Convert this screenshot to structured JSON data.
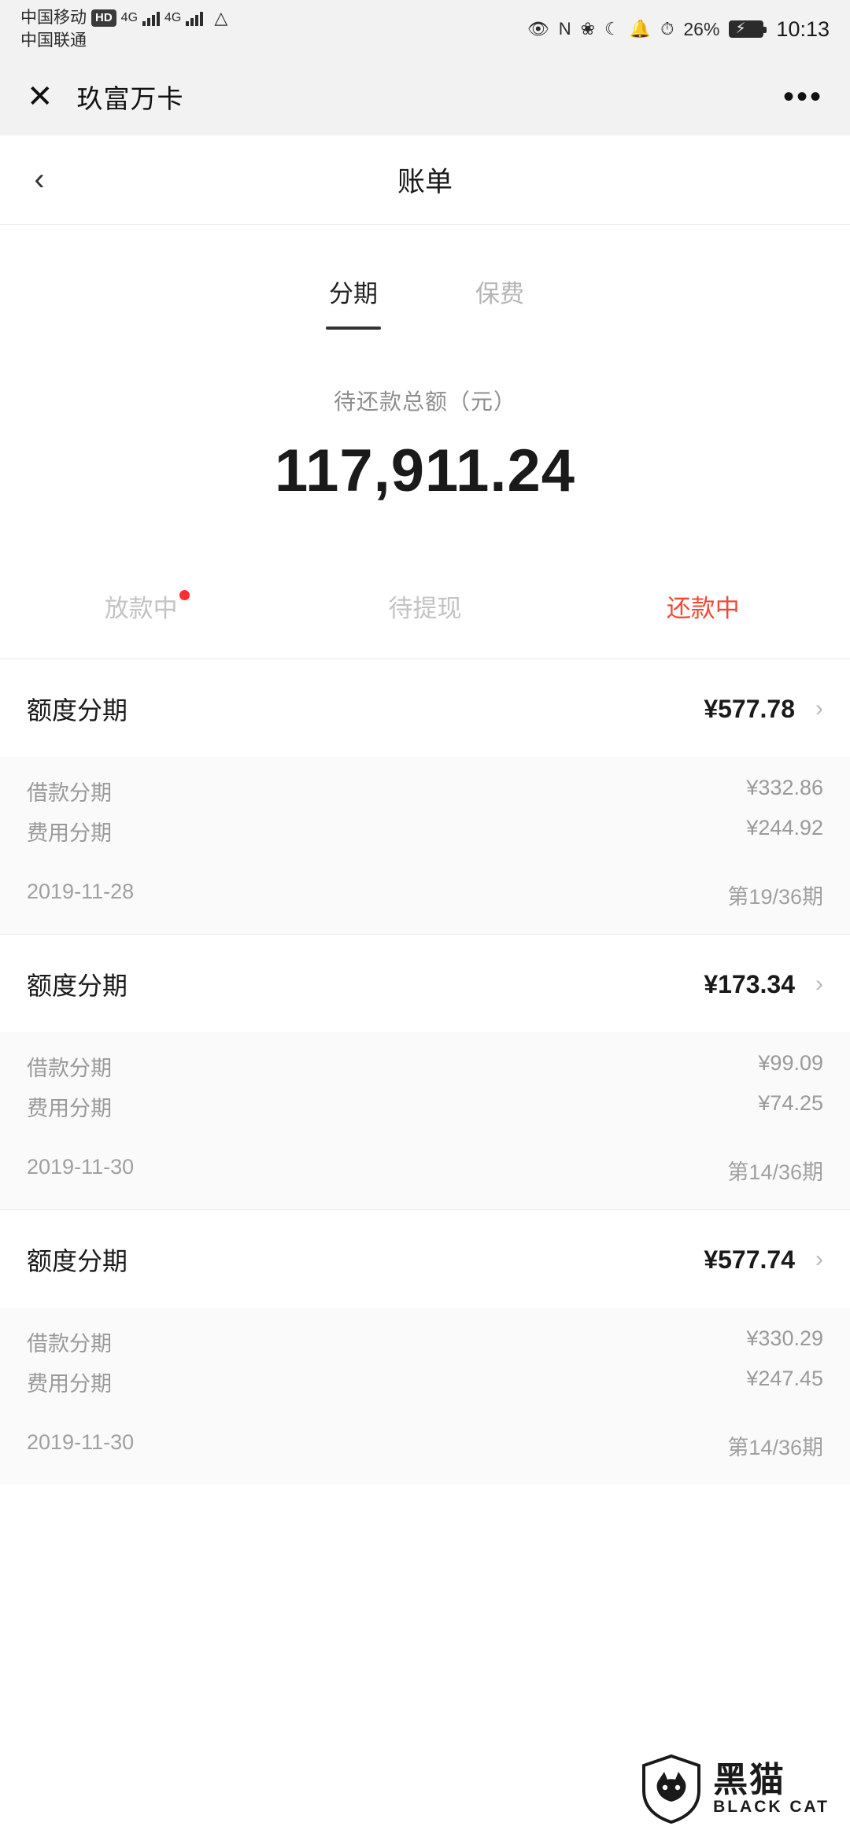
{
  "statusbar": {
    "carrier1": "中国移动",
    "carrier1_badge": "HD",
    "carrier1_net": "4G",
    "carrier2": "中国联通",
    "carrier2_net": "4G",
    "icons": [
      "eye-icon",
      "nfc-icon",
      "bluetooth-icon",
      "moon-icon",
      "bell-off-icon",
      "speed-icon"
    ],
    "nfc_label": "N",
    "battery_percent": "26%",
    "clock": "10:13"
  },
  "miniapp": {
    "close_label": "✕",
    "title": "玖富万卡",
    "more_label": "•••"
  },
  "nav": {
    "back_label": "‹",
    "title": "账单"
  },
  "tabs": [
    {
      "label": "分期",
      "active": true
    },
    {
      "label": "保费",
      "active": false
    }
  ],
  "summary": {
    "label": "待还款总额（元）",
    "value": "117,911.24"
  },
  "statuses": [
    {
      "label": "放款中",
      "dot": true,
      "highlight": false
    },
    {
      "label": "待提现",
      "dot": false,
      "highlight": false
    },
    {
      "label": "还款中",
      "dot": false,
      "highlight": true
    }
  ],
  "bills": [
    {
      "title": "额度分期",
      "amount": "¥577.78",
      "rows": [
        {
          "k": "借款分期",
          "v": "¥332.86"
        },
        {
          "k": "费用分期",
          "v": "¥244.92"
        }
      ],
      "date": "2019-11-28",
      "term": "第19/36期"
    },
    {
      "title": "额度分期",
      "amount": "¥173.34",
      "rows": [
        {
          "k": "借款分期",
          "v": "¥99.09"
        },
        {
          "k": "费用分期",
          "v": "¥74.25"
        }
      ],
      "date": "2019-11-30",
      "term": "第14/36期"
    },
    {
      "title": "额度分期",
      "amount": "¥577.74",
      "rows": [
        {
          "k": "借款分期",
          "v": "¥330.29"
        },
        {
          "k": "费用分期",
          "v": "¥247.45"
        }
      ],
      "date": "2019-11-30",
      "term": "第14/36期"
    }
  ],
  "watermark": {
    "cn": "黑猫",
    "en": "BLACK CAT"
  },
  "colors": {
    "accent_red": "#f04a36",
    "dot_red": "#ff2d2d",
    "muted": "#9a9a9a",
    "bg_grey": "#f2f2f2"
  }
}
